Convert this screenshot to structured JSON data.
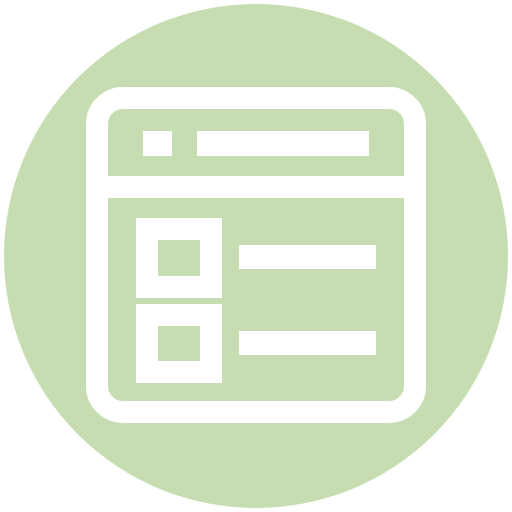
{
  "icon": {
    "name": "browser-window-list-icon",
    "colors": {
      "background_circle": "#c5ddb0",
      "foreground": "#ffffff"
    }
  }
}
